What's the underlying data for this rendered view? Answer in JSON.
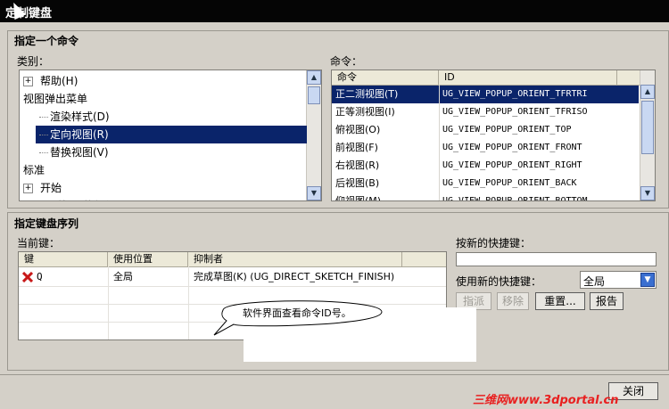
{
  "window": {
    "title": "定制键盘"
  },
  "assign_group": {
    "title": "指定一个命令",
    "category_label": "类别：",
    "categories": [
      {
        "label": "帮助(H)",
        "has_expander": true,
        "expander": "+",
        "indent": 0,
        "selected": false
      },
      {
        "label": "视图弹出菜单",
        "has_expander": false,
        "indent": 0,
        "selected": false
      },
      {
        "label": "渲染样式(D)",
        "has_expander": false,
        "indent": 1,
        "selected": false
      },
      {
        "label": "定向视图(R)",
        "has_expander": false,
        "indent": 1,
        "selected": true
      },
      {
        "label": "替换视图(V)",
        "has_expander": false,
        "indent": 1,
        "selected": false
      },
      {
        "label": "标准",
        "has_expander": false,
        "indent": 0,
        "selected": false
      },
      {
        "label": "开始",
        "has_expander": true,
        "expander": "+",
        "indent": 0,
        "selected": false
      },
      {
        "label": "最近打开的部件(R)",
        "has_expander": true,
        "expander": "+",
        "indent": 0,
        "selected": false
      }
    ],
    "command_label": "命令：",
    "command_columns": [
      "命令",
      "ID"
    ],
    "commands": [
      {
        "name": "正二测视图(T)",
        "id": "UG_VIEW_POPUP_ORIENT_TFRTRI",
        "selected": true
      },
      {
        "name": "正等测视图(I)",
        "id": "UG_VIEW_POPUP_ORIENT_TFRISO",
        "selected": false
      },
      {
        "name": "俯视图(O)",
        "id": "UG_VIEW_POPUP_ORIENT_TOP",
        "selected": false
      },
      {
        "name": "前视图(F)",
        "id": "UG_VIEW_POPUP_ORIENT_FRONT",
        "selected": false
      },
      {
        "name": "右视图(R)",
        "id": "UG_VIEW_POPUP_ORIENT_RIGHT",
        "selected": false
      },
      {
        "name": "后视图(B)",
        "id": "UG_VIEW_POPUP_ORIENT_BACK",
        "selected": false
      },
      {
        "name": "仰视图(M)",
        "id": "UG_VIEW_POPUP_ORIENT_BOTTOM",
        "selected": false
      }
    ]
  },
  "sequence_group": {
    "title": "指定键盘序列",
    "current_keys_label": "当前键：",
    "columns": [
      "键",
      "使用位置",
      "抑制者"
    ],
    "rows": [
      {
        "key": "Q",
        "location": "全局",
        "suppressed_by": "完成草图(K)  (UG_DIRECT_SKETCH_FINISH)",
        "icon": "red-x-icon"
      }
    ],
    "new_shortcut_label": "按新的快捷键：",
    "new_shortcut_value": "",
    "use_new_label": "使用新的快捷键：",
    "use_new_value": "全局",
    "buttons": {
      "assign": "指派",
      "remove": "移除",
      "reset": "重置...",
      "report": "报告"
    }
  },
  "callout": {
    "text": "软件界面查看命令ID号。"
  },
  "footer": {
    "close": "关闭"
  },
  "watermark": {
    "text": "三维网www.3dportal.cn"
  },
  "colors": {
    "selection": "#0a246a",
    "dialog": "#d4d0c8",
    "titlebar": "#050505",
    "watermark": "#e82020"
  }
}
